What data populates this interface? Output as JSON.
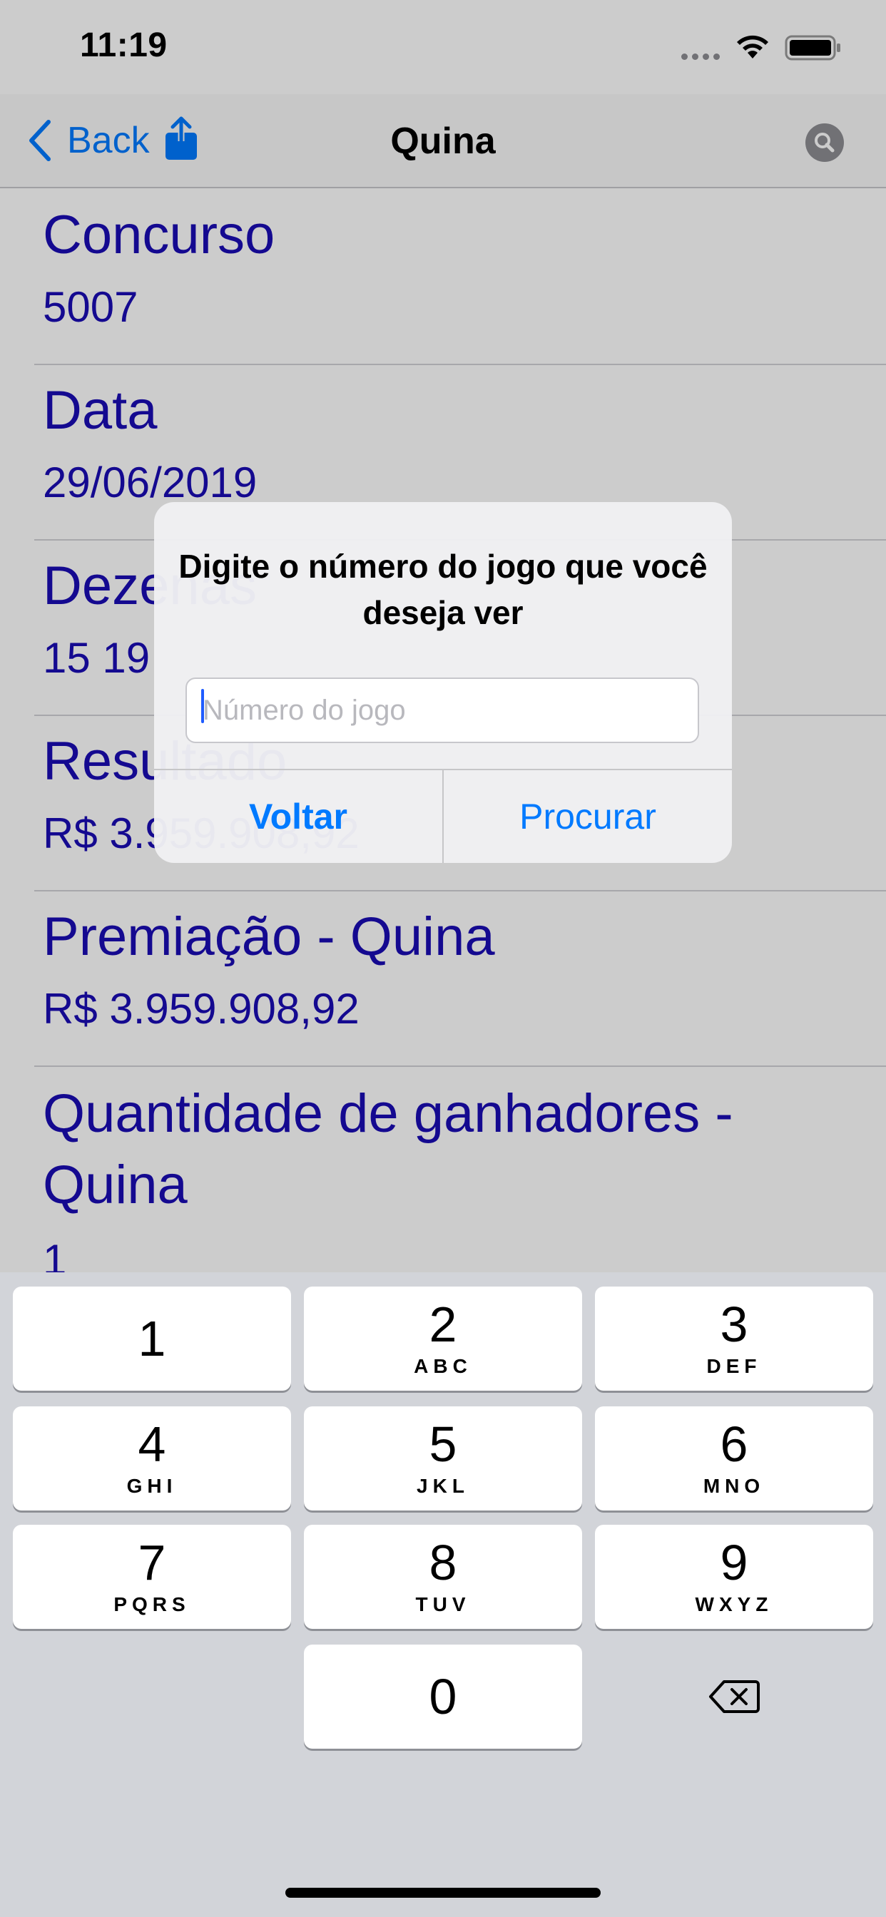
{
  "status_bar": {
    "time": "11:19"
  },
  "nav": {
    "back_label": "Back",
    "title": "Quina"
  },
  "rows": [
    {
      "title": "Concurso",
      "value": "5007"
    },
    {
      "title": "Data",
      "value": "29/06/2019"
    },
    {
      "title": "Dezenas",
      "value": "15   19"
    },
    {
      "title": "Resultado",
      "value": "R$ 3.959.908,92"
    },
    {
      "title": "Premiação - Quina",
      "value": "R$ 3.959.908,92"
    },
    {
      "title": "Quantidade de ganhadores - Quina",
      "value": "1"
    }
  ],
  "alert": {
    "title": "Digite o número do jogo que você deseja ver",
    "input_placeholder": "Número do jogo",
    "input_value": "",
    "cancel_label": "Voltar",
    "confirm_label": "Procurar"
  },
  "keypad": {
    "keys": [
      {
        "num": "1",
        "letters": ""
      },
      {
        "num": "2",
        "letters": "ABC"
      },
      {
        "num": "3",
        "letters": "DEF"
      },
      {
        "num": "4",
        "letters": "GHI"
      },
      {
        "num": "5",
        "letters": "JKL"
      },
      {
        "num": "6",
        "letters": "MNO"
      },
      {
        "num": "7",
        "letters": "PQRS"
      },
      {
        "num": "8",
        "letters": "TUV"
      },
      {
        "num": "9",
        "letters": "WXYZ"
      },
      {
        "num": "0",
        "letters": ""
      }
    ]
  },
  "colors": {
    "accent": "#007aff",
    "content_text": "#1a0cb4",
    "keypad_bg": "#d2d4d9"
  },
  "icons": {
    "back": "chevron-left-icon",
    "share": "share-icon",
    "search": "search-icon",
    "delete": "backspace-icon",
    "wifi": "wifi-icon",
    "battery": "battery-icon"
  }
}
